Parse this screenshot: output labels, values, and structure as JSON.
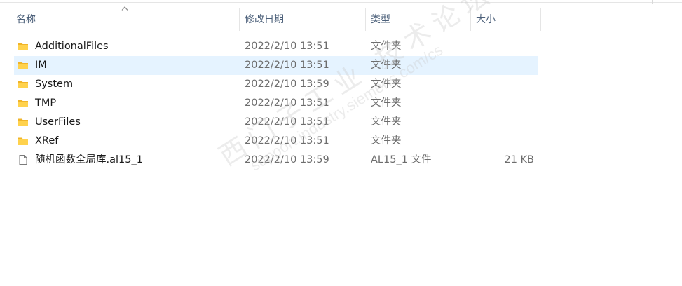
{
  "columns": {
    "name": "名称",
    "date": "修改日期",
    "type": "类型",
    "size": "大小"
  },
  "files": [
    {
      "name": "AdditionalFiles",
      "date": "2022/2/10 13:51",
      "type": "文件夹",
      "size": "",
      "icon": "folder-icon",
      "selected": false
    },
    {
      "name": "IM",
      "date": "2022/2/10 13:51",
      "type": "文件夹",
      "size": "",
      "icon": "folder-icon",
      "selected": true
    },
    {
      "name": "System",
      "date": "2022/2/10 13:59",
      "type": "文件夹",
      "size": "",
      "icon": "folder-icon",
      "selected": false
    },
    {
      "name": "TMP",
      "date": "2022/2/10 13:51",
      "type": "文件夹",
      "size": "",
      "icon": "folder-icon",
      "selected": false
    },
    {
      "name": "UserFiles",
      "date": "2022/2/10 13:51",
      "type": "文件夹",
      "size": "",
      "icon": "folder-icon",
      "selected": false
    },
    {
      "name": "XRef",
      "date": "2022/2/10 13:51",
      "type": "文件夹",
      "size": "",
      "icon": "folder-icon",
      "selected": false
    },
    {
      "name": "随机函数全局库.al15_1",
      "date": "2022/2/10 13:59",
      "type": "AL15_1 文件",
      "size": "21 KB",
      "icon": "file-icon",
      "selected": false
    }
  ],
  "watermark": {
    "main": "西门子工业 技术论坛",
    "sub": "support.industry.siemens.com/cs"
  },
  "colors": {
    "selection": "#e5f3ff",
    "folder": "#ffca28",
    "header_text": "#4c607a"
  }
}
